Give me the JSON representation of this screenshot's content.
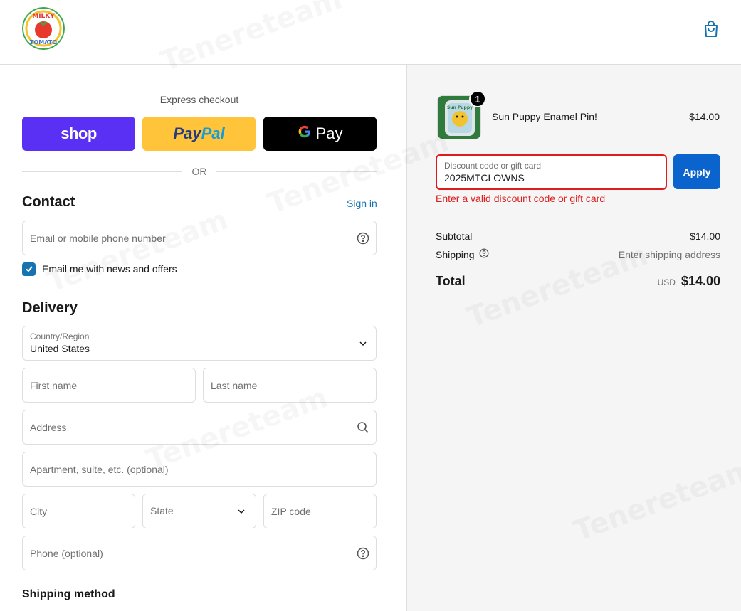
{
  "header": {
    "logo_alt": "MILKY TOMATO",
    "cart_icon": "shopping-bag-icon"
  },
  "express": {
    "label": "Express checkout",
    "shop_label": "shop",
    "paypal_part1": "Pay",
    "paypal_part2": "Pal",
    "gpay_g": "G",
    "gpay_label": "Pay",
    "or_label": "OR"
  },
  "contact": {
    "title": "Contact",
    "signin_label": "Sign in",
    "email_placeholder": "Email or mobile phone number",
    "newsletter_label": "Email me with news and offers",
    "newsletter_checked": true
  },
  "delivery": {
    "title": "Delivery",
    "country_label": "Country/Region",
    "country_value": "United States",
    "first_name_placeholder": "First name",
    "last_name_placeholder": "Last name",
    "address_placeholder": "Address",
    "apartment_placeholder": "Apartment, suite, etc. (optional)",
    "city_placeholder": "City",
    "state_placeholder": "State",
    "zip_placeholder": "ZIP code",
    "phone_placeholder": "Phone (optional)"
  },
  "shipping_method": {
    "title": "Shipping method"
  },
  "order": {
    "item": {
      "name": "Sun Puppy Enamel Pin!",
      "price": "$14.00",
      "quantity": "1",
      "thumb_text": "Sun Puppy"
    },
    "discount": {
      "label": "Discount code or gift card",
      "value": "2025MTCLOWNS",
      "apply_label": "Apply",
      "error": "Enter a valid discount code or gift card"
    },
    "subtotal_label": "Subtotal",
    "subtotal_value": "$14.00",
    "shipping_label": "Shipping",
    "shipping_value": "Enter shipping address",
    "total_label": "Total",
    "currency": "USD",
    "total_value": "$14.00"
  },
  "watermark": "Tenereteam",
  "colors": {
    "accent": "#1773b0",
    "apply": "#0b63ce",
    "error": "#dd1d1d",
    "shop": "#5a31f4",
    "paypal": "#ffc439"
  }
}
